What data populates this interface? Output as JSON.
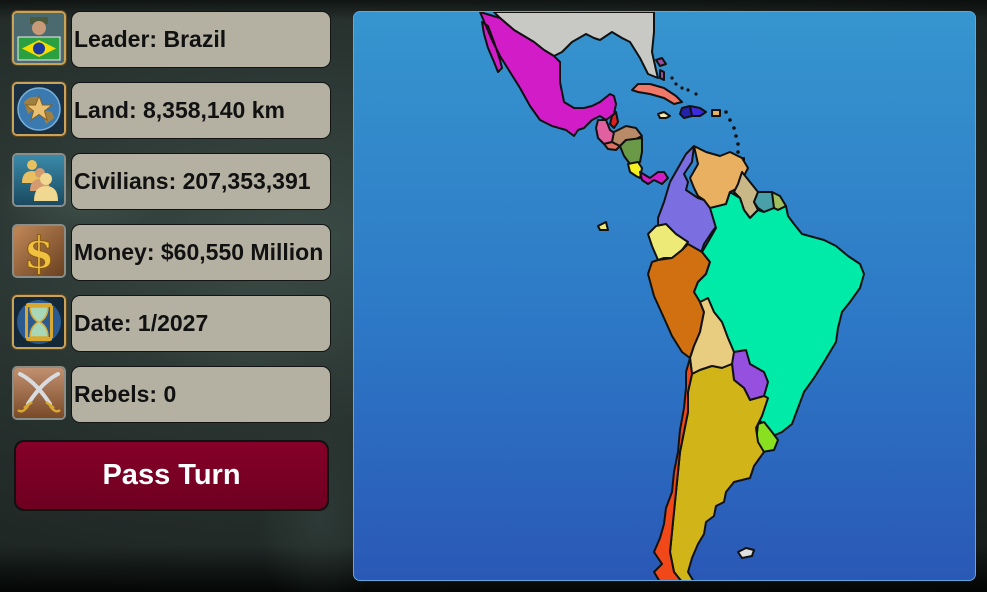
{
  "stats": [
    {
      "id": "leader",
      "icon": "leader-flag-icon",
      "label": "Leader: Brazil"
    },
    {
      "id": "land",
      "icon": "globe-star-icon",
      "label": "Land: 8,358,140 km"
    },
    {
      "id": "civilians",
      "icon": "people-icon",
      "label": "Civilians: 207,353,391"
    },
    {
      "id": "money",
      "icon": "dollar-icon",
      "label": "Money: $60,550 Million"
    },
    {
      "id": "date",
      "icon": "hourglass-icon",
      "label": "Date: 1/2027"
    },
    {
      "id": "rebels",
      "icon": "crossed-swords-icon",
      "label": "Rebels: 0"
    }
  ],
  "pass_turn_label": "Pass Turn",
  "map": {
    "colors": {
      "usa": "#c8c8c4",
      "mexico": "#d21cc8",
      "guatemala": "#e060a0",
      "belize": "#e02020",
      "honduras": "#b88a68",
      "el_salvador": "#e07060",
      "nicaragua": "#6a9a48",
      "costa_rica": "#f5f020",
      "panama": "#d21cc8",
      "cuba": "#f07868",
      "bahamas": "#9a4aa0",
      "jamaica": "#f5e8b0",
      "haiti": "#2222aa",
      "dominican_republic": "#3a2ae0",
      "puerto_rico": "#e8b060",
      "colombia": "#7a6ee0",
      "venezuela": "#e8b060",
      "guyana": "#c8b888",
      "suriname": "#4aa0a8",
      "french_guiana": "#a0c060",
      "ecuador": "#eeea78",
      "galapagos": "#eeea78",
      "peru": "#d07010",
      "brazil": "#00eaa8",
      "bolivia": "#e8cc80",
      "paraguay": "#9650e0",
      "uruguay": "#88e020",
      "argentina": "#d0b418",
      "chile": "#f04818",
      "falklands": "#e0e0e0",
      "trinidad": "#6a6a5a"
    }
  }
}
